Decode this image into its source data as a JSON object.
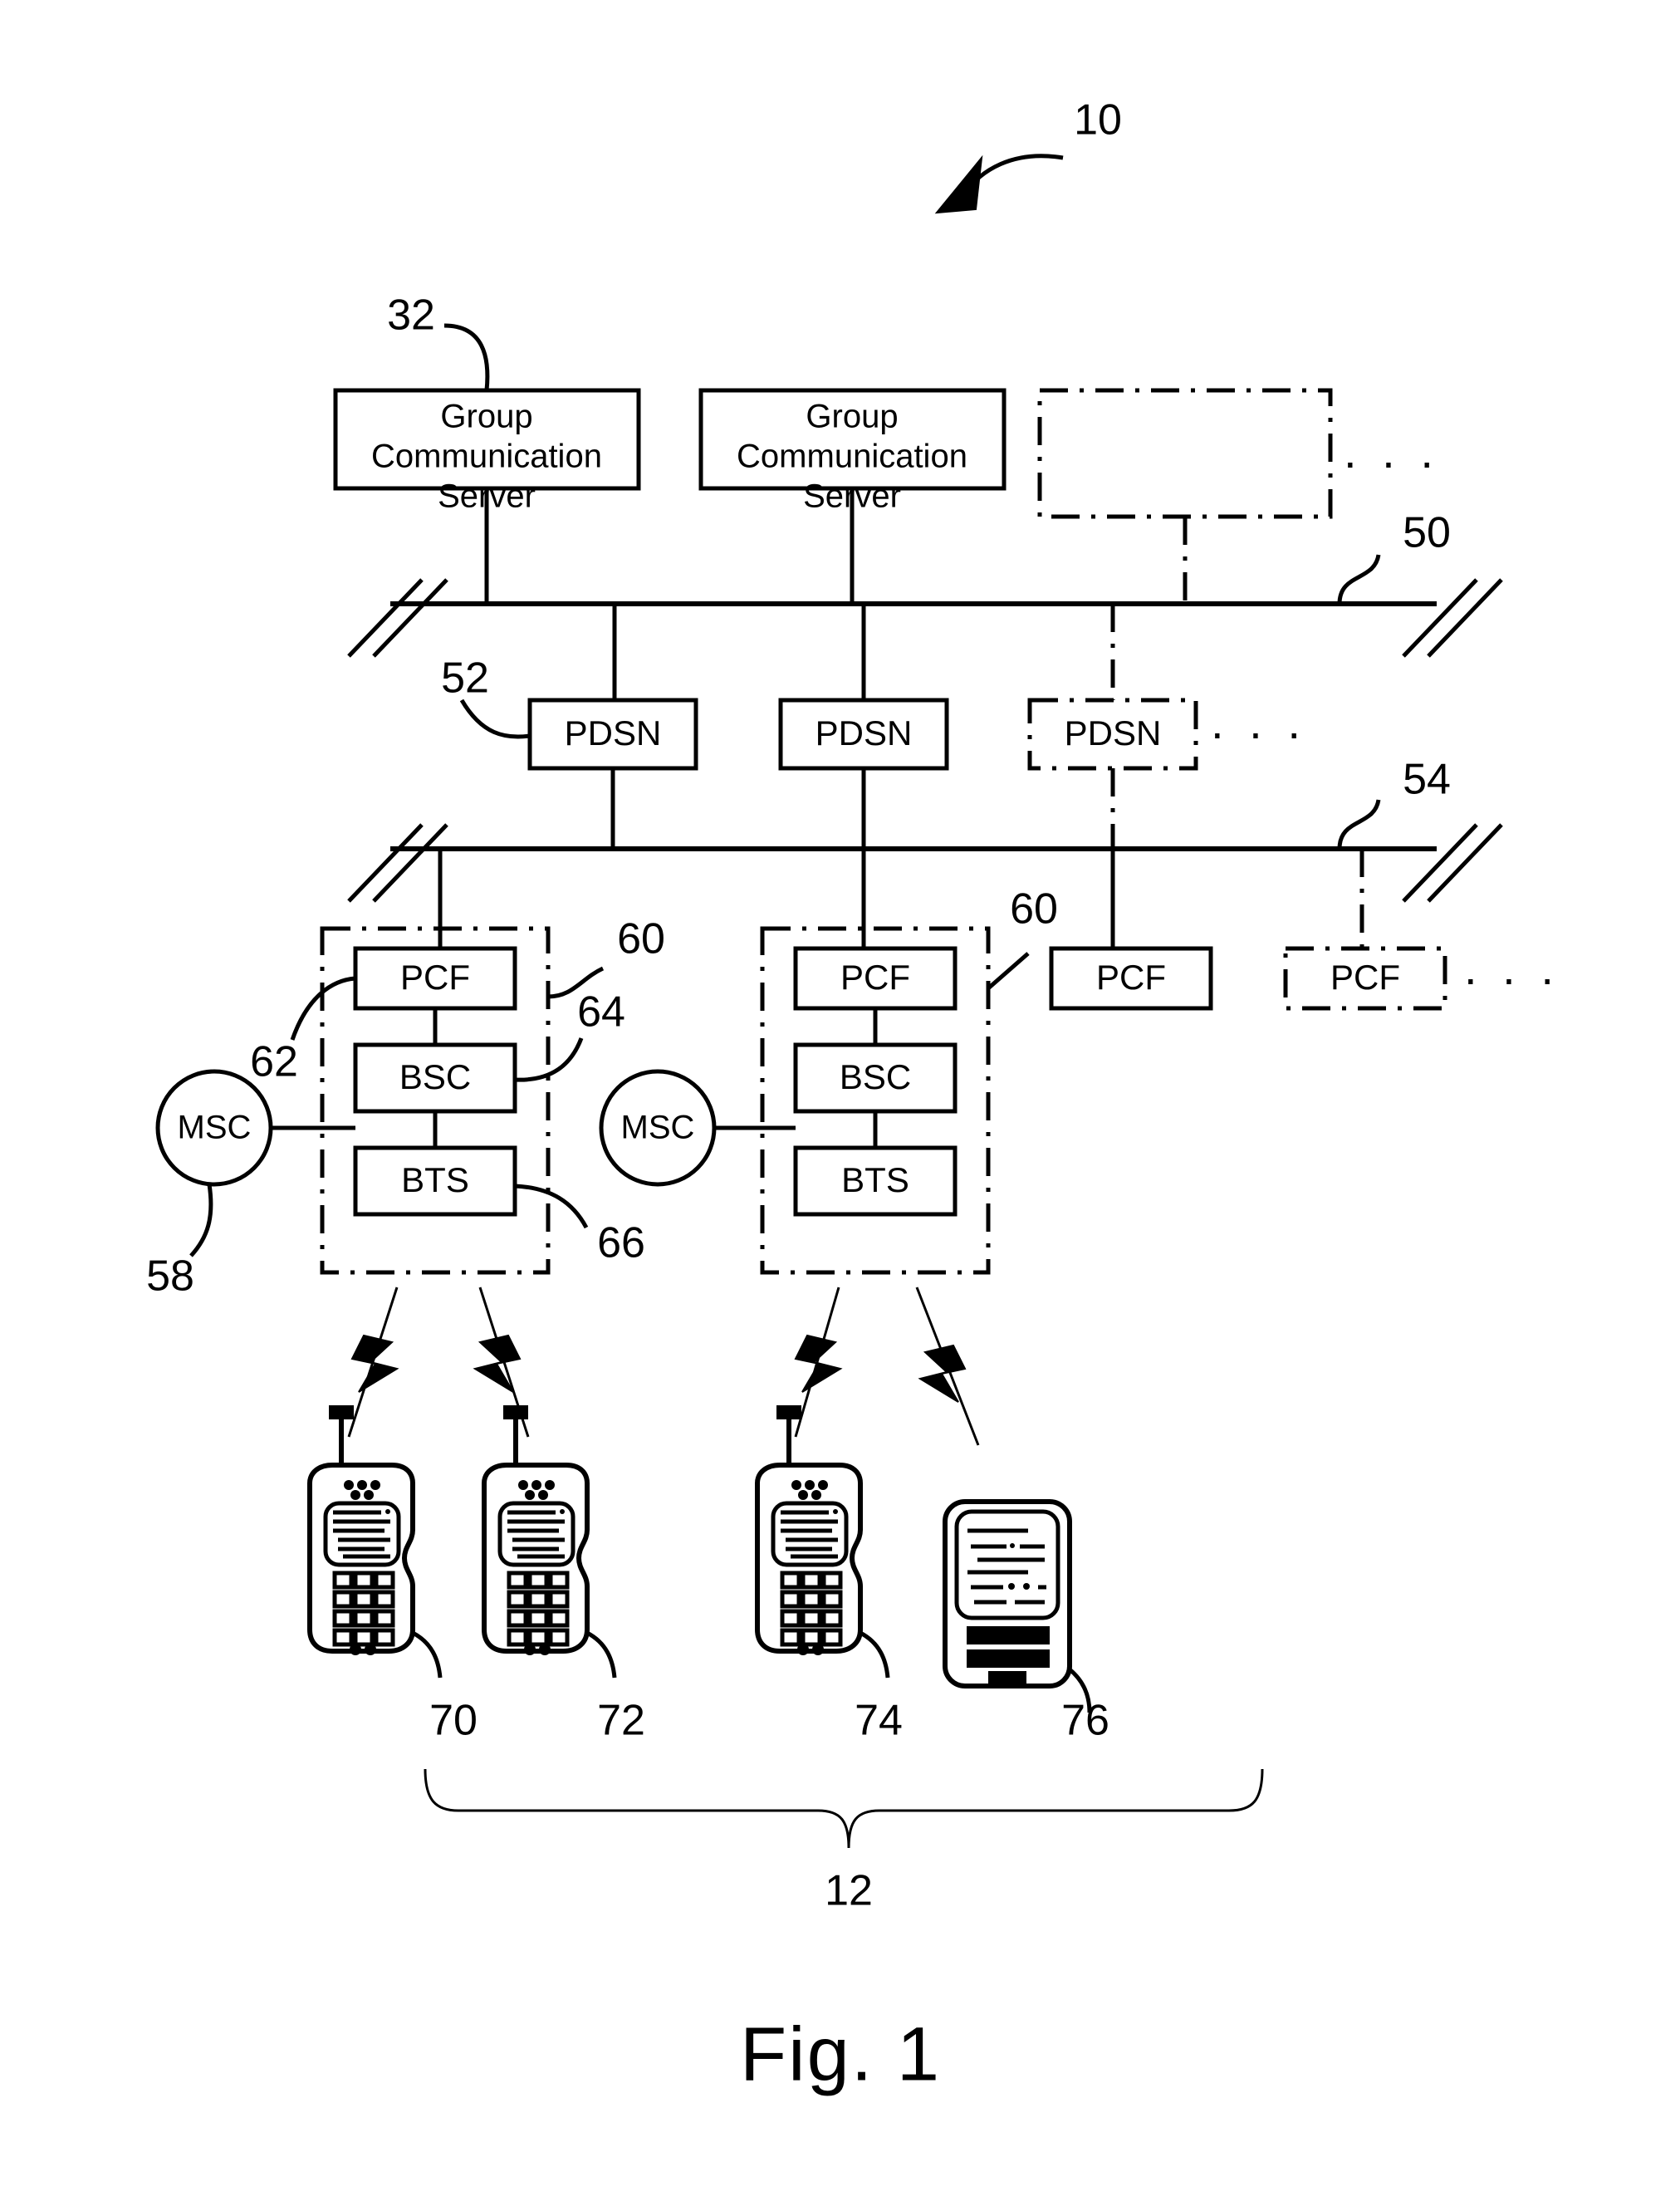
{
  "figure": {
    "caption": "Fig. 1",
    "system_ref": "10"
  },
  "servers": {
    "ref": "32",
    "items": [
      {
        "line1": "Group",
        "line2": "Communication",
        "line3": "Server",
        "style": "solid"
      },
      {
        "line1": "Group",
        "line2": "Communication",
        "line3": "Server",
        "style": "solid"
      },
      {
        "line1": "",
        "line2": "",
        "line3": "",
        "style": "dashdot"
      }
    ],
    "ellipsis": "· · ·"
  },
  "buses": [
    {
      "ref": "50",
      "name": "upper-network-bus"
    },
    {
      "ref": "54",
      "name": "lower-network-bus"
    }
  ],
  "pdsn": {
    "ref": "52",
    "items": [
      {
        "label": "PDSN",
        "style": "solid"
      },
      {
        "label": "PDSN",
        "style": "solid"
      },
      {
        "label": "PDSN",
        "style": "dashdot"
      }
    ],
    "ellipsis": "· · ·"
  },
  "access_networks": {
    "cluster_ref": "60",
    "pcf_ref": "62",
    "bsc_ref": "64",
    "bts_ref": "66",
    "clusters": [
      {
        "pcf": "PCF",
        "bsc": "BSC",
        "bts": "BTS"
      },
      {
        "pcf": "PCF",
        "bsc": "BSC",
        "bts": "BTS"
      }
    ],
    "extra_pcf": [
      {
        "label": "PCF",
        "style": "solid"
      },
      {
        "label": "PCF",
        "style": "dashdot"
      }
    ],
    "ellipsis": "· · ·"
  },
  "msc": {
    "ref": "58",
    "label": "MSC",
    "count": 2
  },
  "devices": {
    "group_ref": "12",
    "items": [
      {
        "ref": "70",
        "type": "mobile-phone"
      },
      {
        "ref": "72",
        "type": "mobile-phone"
      },
      {
        "ref": "74",
        "type": "mobile-phone"
      },
      {
        "ref": "76",
        "type": "pda-device"
      }
    ]
  },
  "colors": {
    "ink": "#000000",
    "paper": "#ffffff"
  }
}
